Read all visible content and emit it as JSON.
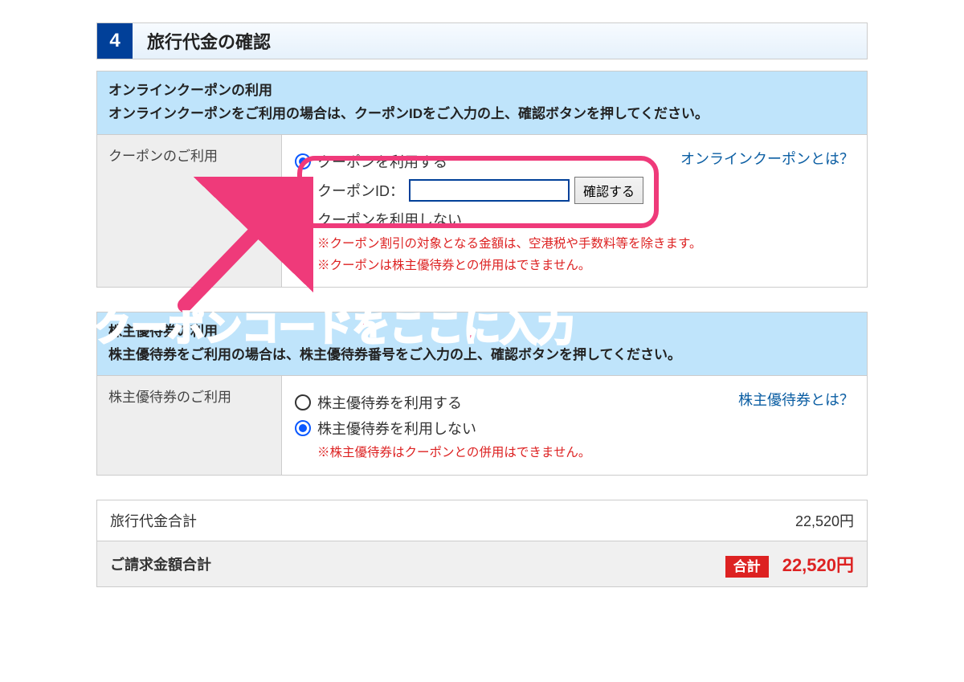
{
  "header": {
    "step_number": "4",
    "title": "旅行代金の確認"
  },
  "coupon": {
    "band_line1": "オンラインクーポンの利用",
    "band_line2": "オンラインクーポンをご利用の場合は、クーポンIDをご入力の上、確認ボタンを押してください。",
    "row_label": "クーポンのご利用",
    "use_label": "クーポンを利用する",
    "id_label": "クーポンID：",
    "confirm": "確認する",
    "not_use_label": "クーポンを利用しない",
    "notice1": "※クーポン割引の対象となる金額は、空港税や手数料等を除きます。",
    "notice2": "※クーポンは株主優待券との併用はできません。",
    "help": "オンラインクーポンとは？"
  },
  "shareholder": {
    "band_line1": "株主優待券の利用",
    "band_line2": "株主優待券をご利用の場合は、株主優待券番号をご入力の上、確認ボタンを押してください。",
    "row_label": "株主優待券のご利用",
    "use_label": "株主優待券を利用する",
    "not_use_label": "株主優待券を利用しない",
    "notice1": "※株主優待券はクーポンとの併用はできません。",
    "help": "株主優待券とは？"
  },
  "totals": {
    "subtotal_label": "旅行代金合計",
    "subtotal_value": "22,520円",
    "grand_label": "ご請求金額合計",
    "tag": "合計",
    "grand_value": "22,520円"
  },
  "annotation_text": "割引クーポンコードをここに入力"
}
